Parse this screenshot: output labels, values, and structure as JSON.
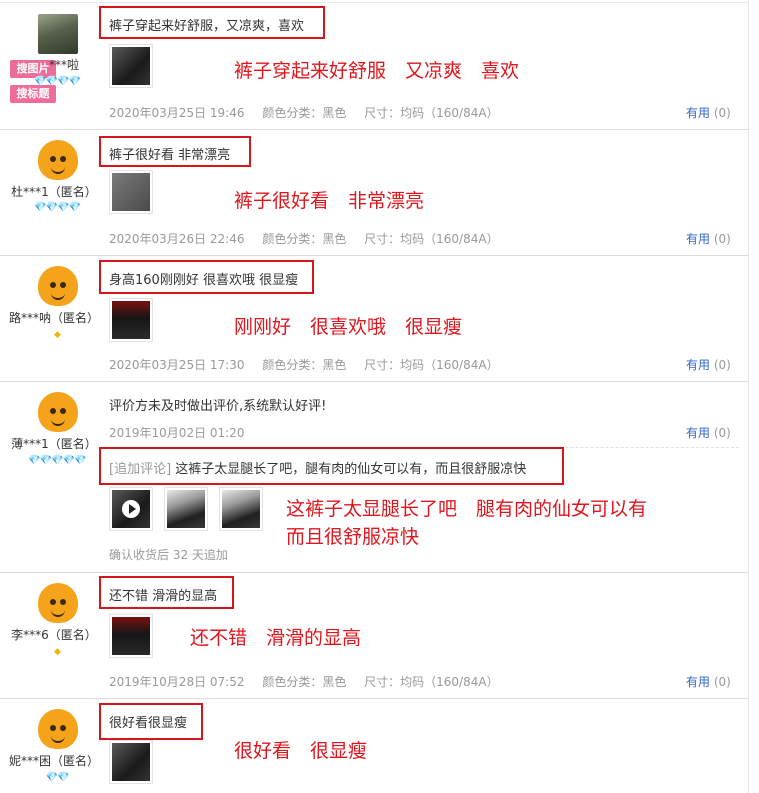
{
  "reviews": [
    {
      "nick": "***啦",
      "gems": "💎💎💎💎",
      "tags": [
        "搜图片",
        "搜标题"
      ],
      "content": "裤子穿起来好舒服，又凉爽，喜欢",
      "note": "裤子穿起来好舒服　又凉爽　喜欢",
      "date": "2020年03月25日 19:46",
      "color_label": "颜色分类：黑色",
      "size_label": "尺寸：均码（160/84A）",
      "useful": "有用",
      "useful_count": "(0)"
    },
    {
      "nick": "杜***1（匿名）",
      "gems": "💎💎💎💎",
      "content": "裤子很好看 非常漂亮",
      "note": "裤子很好看　非常漂亮",
      "date": "2020年03月26日 22:46",
      "color_label": "颜色分类：黑色",
      "size_label": "尺寸：均码（160/84A）",
      "useful": "有用",
      "useful_count": "(0)"
    },
    {
      "nick": "路***呐（匿名）",
      "gems": "◆",
      "content": "身高160刚刚好 很喜欢哦 很显瘦",
      "note": "刚刚好　很喜欢哦　很显瘦",
      "date": "2020年03月25日 17:30",
      "color_label": "颜色分类：黑色",
      "size_label": "尺寸：均码（160/84A）",
      "useful": "有用",
      "useful_count": "(0)"
    },
    {
      "nick": "薄***1（匿名）",
      "gems": "💎💎💎💎💎",
      "content": "评价方未及时做出评价,系统默认好评!",
      "date": "2019年10月02日 01:20",
      "useful": "有用",
      "useful_count": "(0)",
      "append_label": "[追加评论]",
      "append_content": "这裤子太显腿长了吧，腿有肉的仙女可以有，而且很舒服凉快",
      "note_line1": "这裤子太显腿长了吧　腿有肉的仙女可以有",
      "note_line2": "而且很舒服凉快",
      "append_footer": "确认收货后 32 天追加"
    },
    {
      "nick": "李***6（匿名）",
      "gems": "◆",
      "content": "还不错 滑滑的显高",
      "note": "还不错　滑滑的显高",
      "date": "2019年10月28日 07:52",
      "color_label": "颜色分类：黑色",
      "size_label": "尺寸：均码（160/84A）",
      "useful": "有用",
      "useful_count": "(0)"
    },
    {
      "nick": "妮***困（匿名）",
      "gems": "💎💎",
      "content": "很好看很显瘦",
      "note": "很好看　很显瘦"
    }
  ]
}
